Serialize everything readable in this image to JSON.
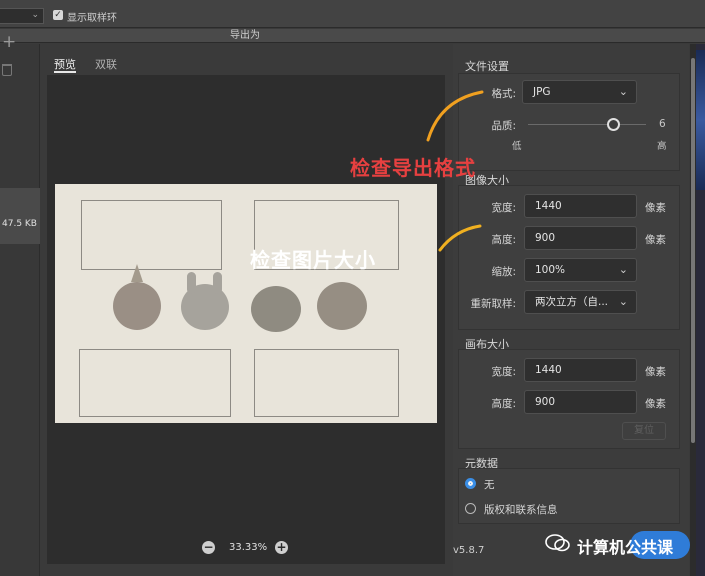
{
  "toolbar": {
    "show_sampling_ring_label": "显示取样环",
    "show_sampling_ring_checked": true
  },
  "dialog": {
    "title": "导出为"
  },
  "left": {
    "file_size": "47.5 KB"
  },
  "preview": {
    "tabs": [
      {
        "label": "预览",
        "active": true
      },
      {
        "label": "双联",
        "active": false
      }
    ],
    "zoom_level": "33.33%"
  },
  "file_settings": {
    "title": "文件设置",
    "format_label": "格式:",
    "format_value": "JPG",
    "quality_label": "品质:",
    "quality_value": "6",
    "quality_low": "低",
    "quality_high": "高"
  },
  "image_size": {
    "title": "图像大小",
    "width_label": "宽度:",
    "width_value": "1440",
    "height_label": "高度:",
    "height_value": "900",
    "unit": "像素",
    "scale_label": "缩放:",
    "scale_value": "100%",
    "resample_label": "重新取样:",
    "resample_value": "两次立方（自..."
  },
  "canvas_size": {
    "title": "画布大小",
    "width_label": "宽度:",
    "width_value": "1440",
    "height_label": "高度:",
    "height_value": "900",
    "unit": "像素",
    "reset_label": "复位"
  },
  "metadata": {
    "title": "元数据",
    "options": [
      {
        "label": "无",
        "selected": true
      },
      {
        "label": "版权和联系信息",
        "selected": false
      }
    ]
  },
  "version": "v5.8.7",
  "annotations": {
    "format_note": "检查导出格式",
    "size_note": "检查图片大小"
  },
  "watermark": {
    "text": "计算机公共课"
  },
  "colors": {
    "accent": "#3a8ee6",
    "annotation_red": "#e64040",
    "annotation_arrow": "#f0a020"
  }
}
